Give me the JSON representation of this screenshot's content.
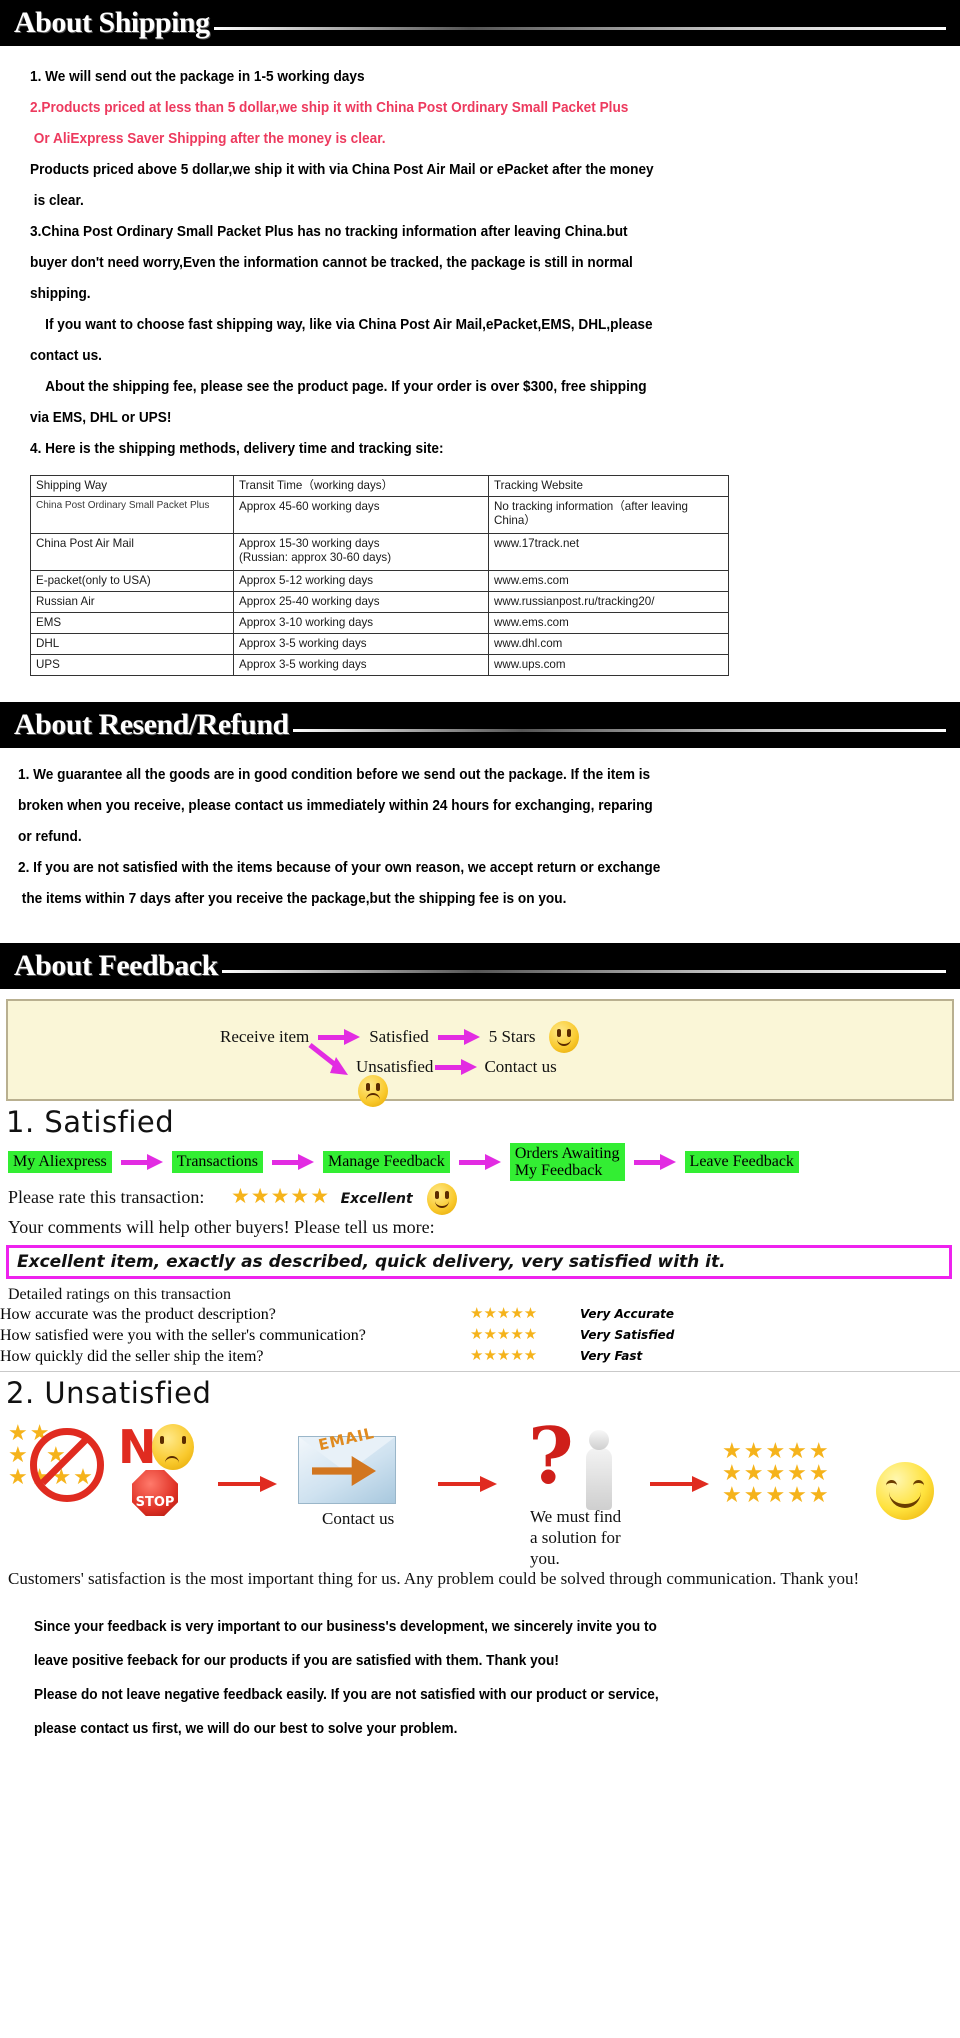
{
  "sections": {
    "shipping": {
      "title": "About Shipping",
      "paragraphs": [
        {
          "text": "1. We will send out the package in 1-5 working days",
          "color": "black"
        },
        {
          "text": "2.Products priced at less than 5 dollar,we ship it with China Post Ordinary Small Packet Plus",
          "color": "red"
        },
        {
          "text": " Or AliExpress Saver Shipping after the money is clear.",
          "color": "red"
        },
        {
          "text": "Products priced above 5 dollar,we ship it with via China Post Air Mail or ePacket after the money",
          "color": "black"
        },
        {
          "text": " is clear.",
          "color": "black"
        },
        {
          "text": "3.China Post Ordinary Small Packet Plus has no tracking information after leaving China.but",
          "color": "black"
        },
        {
          "text": "buyer don't need worry,Even the information cannot be tracked, the package is still in normal",
          "color": "black"
        },
        {
          "text": "shipping.",
          "color": "black"
        },
        {
          "text": "    If you want to choose fast shipping way, like via China Post Air Mail,ePacket,EMS, DHL,please",
          "color": "black"
        },
        {
          "text": "contact us.",
          "color": "black"
        },
        {
          "text": "    About the shipping fee, please see the product page. If your order is over $300, free shipping",
          "color": "black"
        },
        {
          "text": "via EMS, DHL or UPS!",
          "color": "black"
        },
        {
          "text": "4. Here is the shipping methods, delivery time and tracking site:",
          "color": "black"
        }
      ],
      "table": {
        "headers": [
          "Shipping Way",
          "Transit Time（working days）",
          "Tracking Website"
        ],
        "rows": [
          {
            "way": "China Post Ordinary Small Packet Plus",
            "time": "Approx 45-60 working days",
            "site": "No tracking information（after leaving China）"
          },
          {
            "way": "China Post Air Mail",
            "time": "Approx 15-30 working days\n(Russian: approx 30-60 days)",
            "site": "www.17track.net"
          },
          {
            "way": "E-packet(only to USA)",
            "time": "Approx 5-12 working days",
            "site": "www.ems.com"
          },
          {
            "way": "Russian Air",
            "time": "Approx 25-40 working days",
            "site": "www.russianpost.ru/tracking20/"
          },
          {
            "way": "EMS",
            "time": "Approx 3-10 working days",
            "site": "www.ems.com"
          },
          {
            "way": "DHL",
            "time": "Approx 3-5 working days",
            "site": "www.dhl.com"
          },
          {
            "way": "UPS",
            "time": "Approx 3-5 working days",
            "site": "www.ups.com"
          }
        ]
      }
    },
    "refund": {
      "title": "About Resend/Refund",
      "paragraphs": [
        {
          "text": "1. We guarantee all the goods are in good condition before we send out the package. If the item is"
        },
        {
          "text": "broken when you receive, please contact us immediately within 24 hours for exchanging, reparing"
        },
        {
          "text": "or refund."
        },
        {
          "text": "2. If you are not satisfied with the items because of your own reason, we accept return or exchange"
        },
        {
          "text": " the items within 7 days after you receive the package,but the shipping fee is on you."
        }
      ]
    },
    "feedback": {
      "title": "About Feedback",
      "flow": {
        "start": "Receive item",
        "branch_top": "Satisfied",
        "branch_top_result": "5 Stars",
        "branch_bottom": "Unsatisfied",
        "branch_bottom_result": "Contact us"
      },
      "satisfied": {
        "heading": "1. Satisfied",
        "chain": [
          "My Aliexpress",
          "Transactions",
          "Manage Feedback",
          "Orders Awaiting\nMy Feedback",
          "Leave Feedback"
        ],
        "rate_prompt": "Please rate this transaction:",
        "rate_stars": "★★★★★",
        "rate_word": "Excellent",
        "comments_prompt": "Your comments will help other buyers! Please tell us more:",
        "comment_text": "Excellent item, exactly as described, quick delivery, very satisfied with it.",
        "detailed_heading": "Detailed ratings on this transaction",
        "detailed": [
          {
            "question": "How accurate was the product description?",
            "stars": "★★★★★",
            "word": "Very Accurate"
          },
          {
            "question": "How satisfied were you with the seller's communication?",
            "stars": "★★★★★",
            "word": "Very Satisfied"
          },
          {
            "question": "How quickly did the seller ship the item?",
            "stars": "★★★★★",
            "word": "Very Fast"
          }
        ]
      },
      "unsatisfied": {
        "heading": "2. Unsatisfied",
        "no_label": "N",
        "stop_label": "STOP",
        "email_label": "EMAIL",
        "contact_caption": "Contact us",
        "solution_caption": "We must find\na solution for\nyou.",
        "closing": "Customers' satisfaction is the most important thing for us. Any problem could be solved through communication. Thank you!"
      },
      "outro": [
        {
          "text": "Since your feedback is very important to our business's development, we sincerely invite you to"
        },
        {
          "text": "leave positive feeback for our products if you are satisfied with them. Thank you!"
        },
        {
          "text": "Please do not leave negative feedback easily. If you are not satisfied with our product or service,"
        },
        {
          "text": "please contact us first, we will do our best to solve your problem."
        }
      ]
    }
  },
  "colors": {
    "accent_red": "#ed3a5e",
    "bar_black": "#000000",
    "chip_green": "#33ee33",
    "arrow_magenta": "#e22ce2",
    "star_gold": "#f5b31b",
    "panel_cream": "#faf6d7"
  }
}
